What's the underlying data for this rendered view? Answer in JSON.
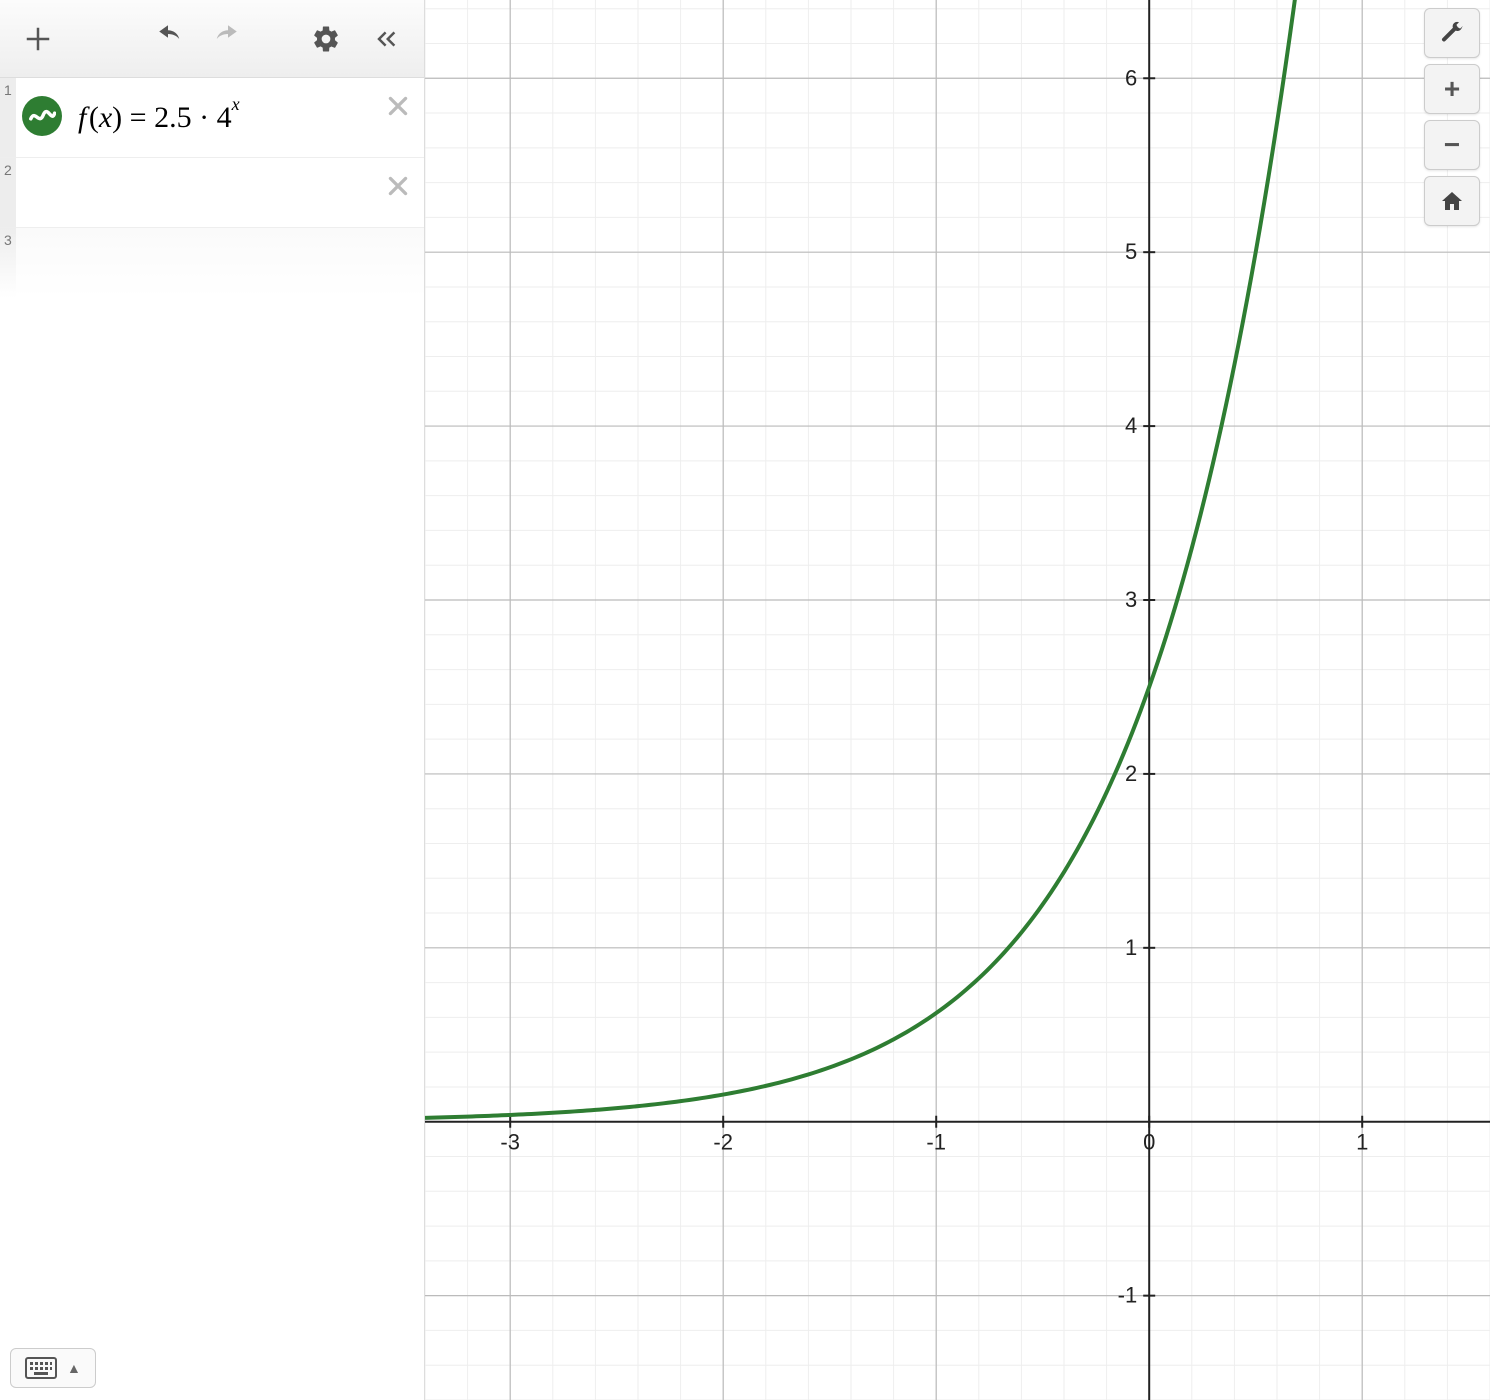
{
  "toolbar": {
    "add": "+",
    "undo": "undo",
    "redo": "redo",
    "settings": "settings",
    "collapse": "«"
  },
  "expressions": {
    "rows": [
      {
        "num": "1",
        "latex_display": "f(x) = 2.5 · 4ˣ",
        "hasBadge": true,
        "deletable": true
      },
      {
        "num": "2",
        "latex_display": "",
        "hasBadge": false,
        "deletable": true
      },
      {
        "num": "3",
        "latex_display": "",
        "hasBadge": false,
        "deletable": false
      }
    ]
  },
  "graph_controls": {
    "wrench": "settings-wrench",
    "zoom_in": "+",
    "zoom_out": "−",
    "home": "home"
  },
  "colors": {
    "curve": "#2e7d32"
  },
  "chart_data": {
    "type": "line",
    "title": "",
    "xlabel": "",
    "ylabel": "",
    "xlim": [
      -3.4,
      1.6
    ],
    "ylim": [
      -1.6,
      6.45
    ],
    "x_ticks": [
      -3,
      -2,
      -1,
      0,
      1
    ],
    "y_ticks": [
      -1,
      1,
      2,
      3,
      4,
      5,
      6
    ],
    "series": [
      {
        "name": "f(x) = 2.5 · 4^x",
        "formula": "2.5 * 4^x",
        "x": [
          -3.4,
          -3,
          -2.5,
          -2,
          -1.5,
          -1,
          -0.75,
          -0.5,
          -0.25,
          0,
          0.2,
          0.4,
          0.5,
          0.6,
          0.7
        ],
        "y": [
          0.0223,
          0.0391,
          0.0781,
          0.1563,
          0.3125,
          0.625,
          0.8839,
          1.25,
          1.7678,
          2.5,
          3.2988,
          4.353,
          5.0,
          5.7435,
          6.598
        ]
      }
    ]
  }
}
